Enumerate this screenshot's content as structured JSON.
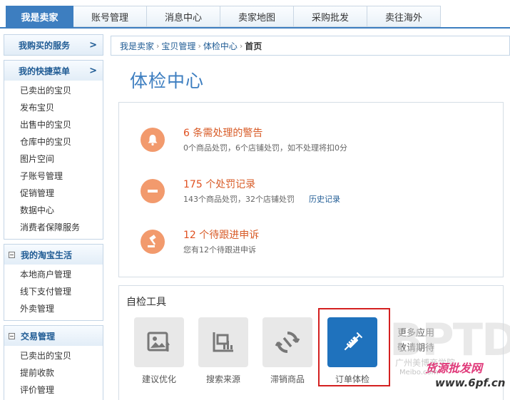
{
  "topnav": {
    "tabs": [
      {
        "label": "我是卖家"
      },
      {
        "label": "账号管理"
      },
      {
        "label": "消息中心"
      },
      {
        "label": "卖家地图"
      },
      {
        "label": "采购批发"
      },
      {
        "label": "卖往海外"
      }
    ]
  },
  "sidebar": {
    "services": {
      "title": "我购买的服务",
      "chevron": ">"
    },
    "quick_menu": {
      "title": "我的快捷菜单",
      "chevron": ">",
      "items": [
        "已卖出的宝贝",
        "发布宝贝",
        "出售中的宝贝",
        "仓库中的宝贝",
        "图片空间",
        "子账号管理",
        "促销管理",
        "数据中心",
        "消费者保障服务"
      ]
    },
    "taobao_life": {
      "title": "我的淘宝生活",
      "items": [
        "本地商户管理",
        "线下支付管理",
        "外卖管理"
      ]
    },
    "trade": {
      "title": "交易管理",
      "items": [
        "已卖出的宝贝",
        "提前收款",
        "评价管理"
      ]
    }
  },
  "breadcrumb": {
    "items": [
      "我是卖家",
      "宝贝管理",
      "体检中心"
    ],
    "separator": "›",
    "current": "首页"
  },
  "page_title": "体检中心",
  "alerts": [
    {
      "count": "6",
      "label": "条需处理的警告",
      "detail": "0个商品处罚，6个店铺处罚，如不处理将扣",
      "detail_value": "0",
      "detail_suffix": "分",
      "icon": "bell-icon"
    },
    {
      "count": "175",
      "label": "个处罚记录",
      "detail": "143个商品处罚，32个店铺处罚",
      "link": "历史记录",
      "icon": "minus-icon"
    },
    {
      "count": "12",
      "label": "个待跟进申诉",
      "detail": "您有12个待跟进申诉",
      "icon": "gavel-icon"
    }
  ],
  "tools": {
    "title": "自检工具",
    "items": [
      {
        "label": "建议优化",
        "icon": "image-upload-icon"
      },
      {
        "label": "搜索来源",
        "icon": "chart-bars-icon"
      },
      {
        "label": "滞销商品",
        "icon": "refresh-icon"
      },
      {
        "label": "订单体检",
        "icon": "syringe-icon"
      }
    ],
    "more_line1": "更多应用",
    "more_line2": "敬请期待"
  },
  "watermark": {
    "logo": "BPTD",
    "line1": "广州美博商学院",
    "brand": "货源批发网",
    "url_small": "Meibo.com",
    "url": "www.6pf.cn"
  },
  "colors": {
    "primary_blue": "#3d7ec0",
    "alert_orange": "#f29a6d",
    "highlight_red": "#d42020",
    "tool_blue": "#1f72bd"
  }
}
